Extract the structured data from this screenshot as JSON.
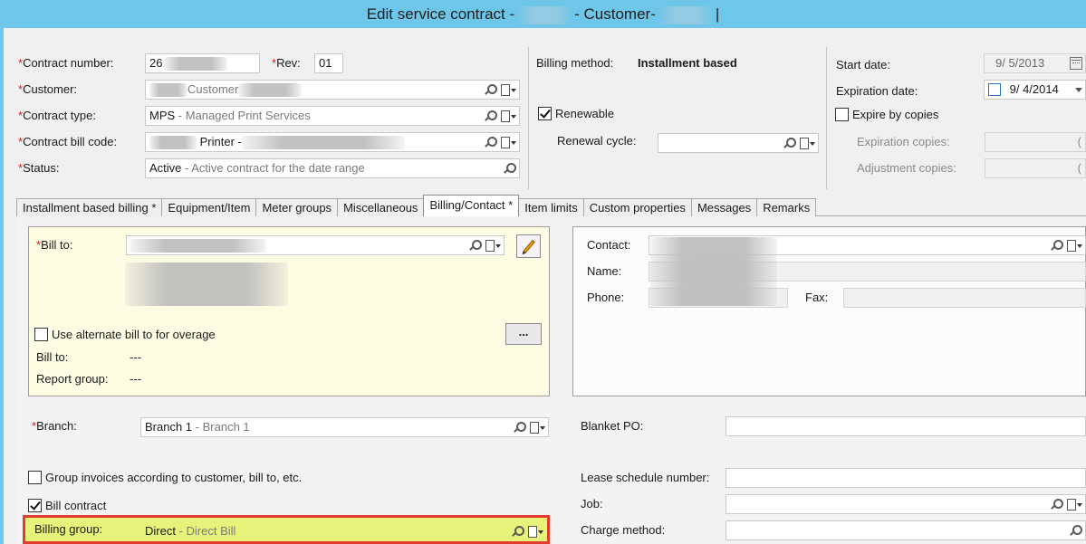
{
  "window": {
    "title_prefix": "Edit service contract -",
    "title_mid": "- Customer-",
    "title_suffix": "|"
  },
  "header": {
    "contract_number": {
      "label": "Contract number:",
      "value": "26"
    },
    "rev": {
      "label": "Rev:",
      "value": "01"
    },
    "customer": {
      "label": "Customer:",
      "value": "Customer"
    },
    "contract_type": {
      "label": "Contract type:",
      "code": "MPS",
      "desc": "- Managed Print Services"
    },
    "contract_bill_code": {
      "label": "Contract bill code:",
      "value": "Printer -"
    },
    "status": {
      "label": "Status:",
      "code": "Active",
      "desc": "- Active contract for the date range"
    },
    "billing_method": {
      "label": "Billing method:",
      "value": "Installment based"
    },
    "renewable": {
      "label": "Renewable",
      "checked": true
    },
    "renewal_cycle": {
      "label": "Renewal cycle:",
      "value": ""
    },
    "start_date": {
      "label": "Start date:",
      "value": "9/ 5/2013"
    },
    "expiration_date": {
      "label": "Expiration date:",
      "value": "9/ 4/2014"
    },
    "expire_by_copies": {
      "label": "Expire by copies",
      "checked": false
    },
    "expiration_copies": {
      "label": "Expiration copies:",
      "value": "("
    },
    "adjustment_copies": {
      "label": "Adjustment copies:",
      "value": "("
    },
    "required_mark": "*"
  },
  "tabs": [
    {
      "label": "Installment based billing *",
      "active": false
    },
    {
      "label": "Equipment/Item",
      "active": false
    },
    {
      "label": "Meter groups",
      "active": false
    },
    {
      "label": "Miscellaneous",
      "active": false
    },
    {
      "label": "Billing/Contact *",
      "active": true
    },
    {
      "label": "Item limits",
      "active": false
    },
    {
      "label": "Custom properties",
      "active": false
    },
    {
      "label": "Messages",
      "active": false
    },
    {
      "label": "Remarks",
      "active": false
    }
  ],
  "billing": {
    "bill_to": {
      "label": "Bill to:",
      "value": ""
    },
    "use_alternate": {
      "label": "Use alternate bill to for overage",
      "checked": false
    },
    "alt_bill_to": {
      "label": "Bill to:",
      "value": "---"
    },
    "report_group": {
      "label": "Report group:",
      "value": "---"
    },
    "dots_label": "...",
    "branch": {
      "label": "Branch:",
      "code": "Branch 1",
      "desc": "- Branch 1"
    },
    "group_invoices": {
      "label": "Group invoices according to customer, bill to, etc.",
      "checked": false
    },
    "bill_contract": {
      "label": "Bill contract",
      "checked": true
    },
    "billing_group": {
      "label": "Billing group:",
      "code": "Direct",
      "desc": "- Direct Bill"
    }
  },
  "contact": {
    "contact": {
      "label": "Contact:",
      "value": ""
    },
    "name": {
      "label": "Name:",
      "value": ""
    },
    "phone": {
      "label": "Phone:",
      "value": ""
    },
    "fax": {
      "label": "Fax:",
      "value": ""
    },
    "blanket_po": {
      "label": "Blanket PO:",
      "value": ""
    },
    "lease_schedule": {
      "label": "Lease schedule number:",
      "value": ""
    },
    "job": {
      "label": "Job:",
      "value": ""
    },
    "charge_method": {
      "label": "Charge method:",
      "value": ""
    }
  },
  "colors": {
    "titlebar": "#6ec6e8",
    "required": "#d21f1f",
    "panel_yellow": "#fdfde4",
    "highlight_border": "#e03d2f",
    "highlight_fill": "#e6f27a"
  },
  "icons": [
    "search-icon",
    "document-dropdown-icon",
    "calendar-icon",
    "edit-pencil-icon",
    "checkbox"
  ]
}
